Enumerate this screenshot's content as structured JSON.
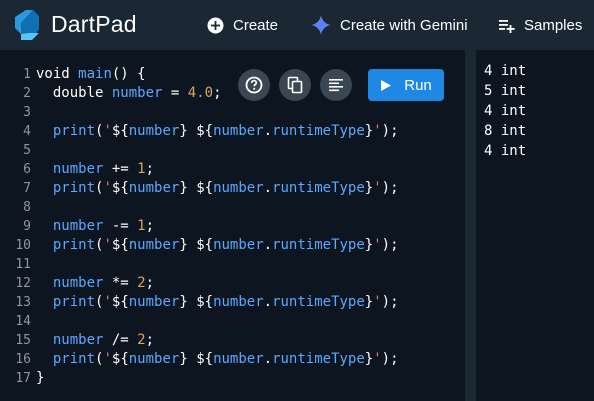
{
  "header": {
    "title": "DartPad",
    "nav": [
      {
        "label": "Create",
        "icon": "plus-circle-icon"
      },
      {
        "label": "Create with Gemini",
        "icon": "gemini-sparkle-icon"
      },
      {
        "label": "Samples",
        "icon": "playlist-add-icon"
      }
    ]
  },
  "toolbar": {
    "help_icon": "help-icon",
    "copy_icon": "copy-icon",
    "format_icon": "format-icon",
    "run_label": "Run"
  },
  "colors": {
    "background": "#1b2733",
    "editor_bg": "#0d1620",
    "accent": "#1f88e5",
    "keyword": "#ffffff",
    "identifier": "#5aa8ff",
    "number": "#d2a85b",
    "string": "#e07b66"
  },
  "editor": {
    "line_numbers": [
      "1",
      "2",
      "3",
      "4",
      "5",
      "6",
      "7",
      "8",
      "9",
      "10",
      "11",
      "12",
      "13",
      "14",
      "15",
      "16",
      "17"
    ],
    "lines": [
      "void main() {",
      "  double number = 4.0;",
      "",
      "  print('${number} ${number.runtimeType}');",
      "",
      "  number += 1;",
      "  print('${number} ${number.runtimeType}');",
      "",
      "  number -= 1;",
      "  print('${number} ${number.runtimeType}');",
      "",
      "  number *= 2;",
      "  print('${number} ${number.runtimeType}');",
      "",
      "  number /= 2;",
      "  print('${number} ${number.runtimeType}');",
      "}"
    ]
  },
  "output": {
    "lines": [
      "4 int",
      "5 int",
      "4 int",
      "8 int",
      "4 int"
    ]
  }
}
